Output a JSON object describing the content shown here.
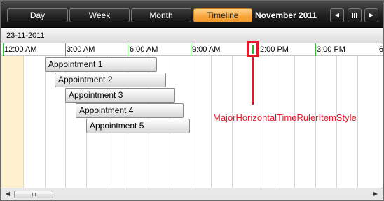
{
  "toolbar": {
    "views": [
      {
        "label": "Day",
        "active": false
      },
      {
        "label": "Week",
        "active": false
      },
      {
        "label": "Month",
        "active": false
      },
      {
        "label": "Timeline",
        "active": true
      }
    ],
    "period_title": "November 2011",
    "prev_icon": "chevron-left-icon",
    "calendar_icon": "calendar-icon",
    "next_icon": "chevron-right-icon"
  },
  "date_header": {
    "label": "23-11-2011"
  },
  "ruler": {
    "labels": [
      "12:00 AM",
      "3:00 AM",
      "6:00 AM",
      "9:00 AM",
      "2:00 PM",
      "3:00 PM",
      "6"
    ]
  },
  "appointments": [
    {
      "subject": "Appointment 1"
    },
    {
      "subject": "Appointment 2"
    },
    {
      "subject": "Appointment 3"
    },
    {
      "subject": "Appointment 4"
    },
    {
      "subject": "Appointment 5"
    }
  ],
  "callout": {
    "label": "MajorHorizontalTimeRulerItemStyle",
    "color": "#e2192a"
  },
  "colors": {
    "accent_active": "#f7a53b",
    "major_tick": "#2fb52f",
    "off_hours": "#fdf1d0"
  }
}
